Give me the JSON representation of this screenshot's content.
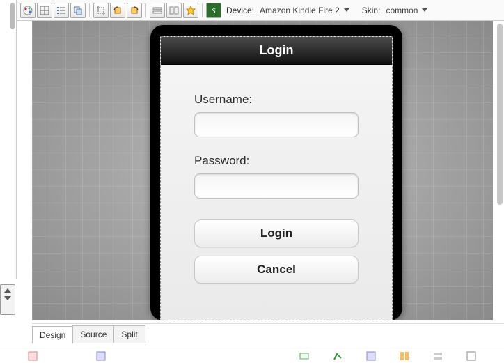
{
  "toolbar": {
    "device_label": "Device:",
    "device_value": "Amazon Kindle Fire 2",
    "skin_label": "Skin:",
    "skin_value": "common",
    "icons": [
      "palette-icon",
      "grid-icon",
      "list-icon",
      "copy-icon",
      "crop-icon",
      "rotate-left-icon",
      "rotate-right-icon",
      "align-icon",
      "columns-icon",
      "star-icon",
      "script-icon"
    ]
  },
  "device_preview": {
    "title": "Login",
    "form": {
      "username_label": "Username:",
      "username_value": "",
      "password_label": "Password:",
      "password_value": "",
      "login_button": "Login",
      "cancel_button": "Cancel"
    }
  },
  "tabs": {
    "items": [
      "Design",
      "Source",
      "Split"
    ],
    "active_index": 0
  }
}
